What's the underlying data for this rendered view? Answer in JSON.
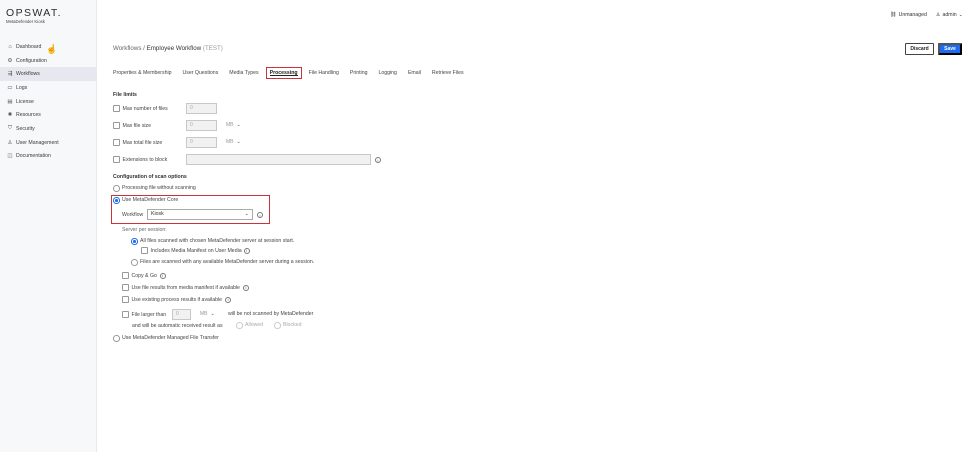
{
  "brand": {
    "name": "OPSWAT.",
    "product": "MetaDefender Kiosk"
  },
  "sidebar": {
    "items": [
      {
        "label": "Dashboard",
        "icon": "home-icon"
      },
      {
        "label": "Configuration",
        "icon": "gear-icon"
      },
      {
        "label": "Workflows",
        "icon": "workflow-icon"
      },
      {
        "label": "Logs",
        "icon": "folder-icon"
      },
      {
        "label": "License",
        "icon": "license-icon"
      },
      {
        "label": "Resources",
        "icon": "resources-icon"
      },
      {
        "label": "Security",
        "icon": "shield-icon"
      },
      {
        "label": "User Management",
        "icon": "user-icon"
      },
      {
        "label": "Documentation",
        "icon": "book-icon"
      }
    ],
    "active_item": "Workflows"
  },
  "topbar": {
    "status": "Unmanaged",
    "user": "admin"
  },
  "breadcrumb": {
    "parent": "Workflows",
    "separator": "/",
    "current": "Employee Workflow",
    "tag": "(TEST)"
  },
  "actions": {
    "discard": "Discard",
    "save": "Save"
  },
  "tabs": [
    "Properties & Membership",
    "User Questions",
    "Media Types",
    "Processing",
    "File Handling",
    "Printing",
    "Logging",
    "Email",
    "Retrieve Files"
  ],
  "active_tab": "Processing",
  "file_limits": {
    "title": "File limits",
    "max_files": {
      "label": "Max number of files",
      "value": "0"
    },
    "max_file_size": {
      "label": "Max file size",
      "value": "0",
      "unit": "MB"
    },
    "max_total_size": {
      "label": "Max total file size",
      "value": "0",
      "unit": "MB"
    },
    "extensions": {
      "label": "Extensions to block",
      "value": ""
    }
  },
  "scan": {
    "title": "Configuration of scan options",
    "opt_no_scan": "Processing file without scanning",
    "opt_core": "Use MetaDefender Core",
    "workflow_label": "Workflow",
    "workflow_value": "Kiosk",
    "server_per_session": "Server per session:",
    "server_all": "All files scanned with chosen MetaDefender server at session start.",
    "includes_manifest": "Includes Media Manifest on User Media",
    "server_any": "Files are scanned with any available MetaDefender server during a session.",
    "copy_go": "Copy & Go",
    "use_manifest": "Use file results from media manifest if available",
    "use_existing": "Use existing process results if available",
    "larger_than": "File larger than",
    "larger_value": "0",
    "larger_unit": "MB",
    "not_scanned": "will be not scanned by MetaDefender",
    "auto_result": "and will be automatic received result as",
    "allowed": "Allowed",
    "blocked": "Blocked",
    "opt_mft": "Use MetaDefender Managed File Transfer"
  },
  "colors": {
    "accent": "#1d6bf3",
    "highlight": "#c9333b"
  }
}
